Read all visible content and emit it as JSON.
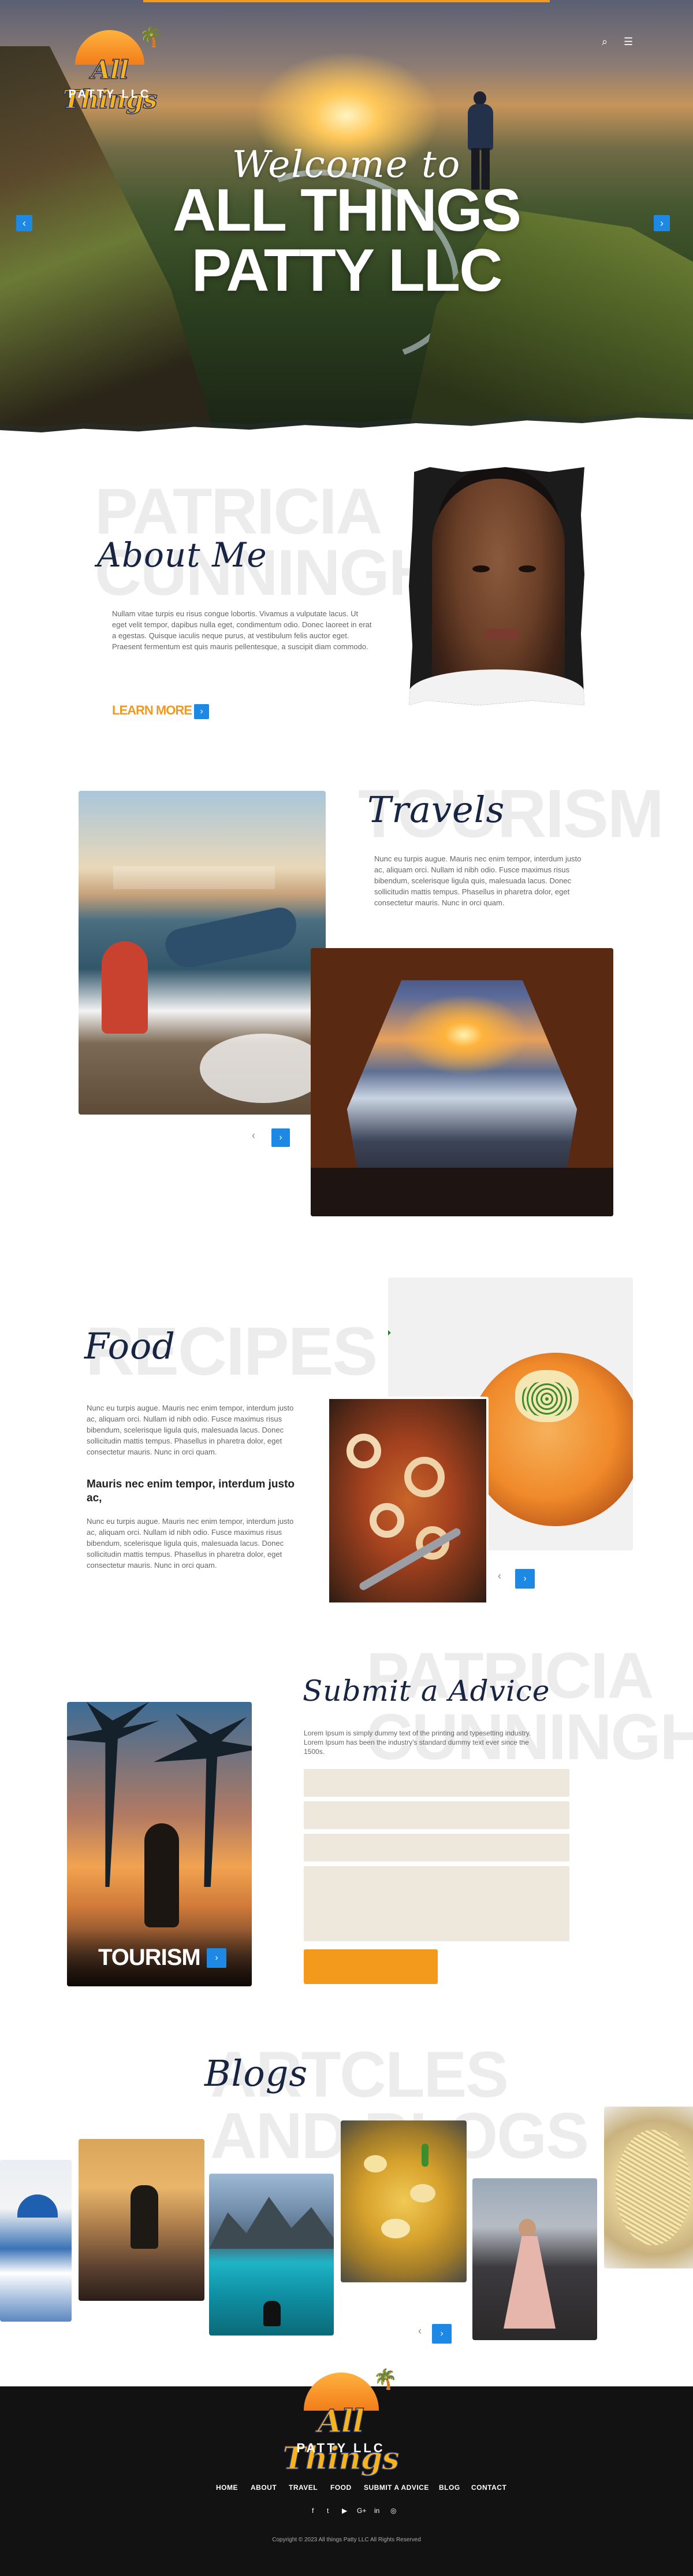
{
  "hero": {
    "welcome": "Welcome to",
    "title_line1": "ALL THINGS",
    "title_line2": "PATTY LLC",
    "prev": "‹",
    "next": "›",
    "search_icon": "⌕",
    "menu_icon": "☰"
  },
  "logo": {
    "line1": "All Things",
    "line2": "PATTY LLC"
  },
  "about": {
    "ghost_line1": "PATRICIA",
    "ghost_line2": "CUNNINGHAM",
    "heading": "About Me",
    "text": "Nullam vitae turpis eu risus congue lobortis. Vivamus a vulputate lacus. Ut eget velit tempor, dapibus nulla eget, condimentum odio. Donec laoreet in erat a egestas. Quisque iaculis neque purus, at vestibulum felis auctor eget. Praesent fermentum est quis mauris pellentesque, a suscipit diam commodo.",
    "cta": "LEARN MORE",
    "cta_icon": "›"
  },
  "travels": {
    "ghost": "TOURISM",
    "heading": "Travels",
    "text": "Nunc eu turpis augue. Mauris nec enim tempor, interdum justo ac, aliquam orci. Nullam id nibh odio. Fusce maximus risus bibendum, scelerisque ligula quis, malesuada lacus. Donec sollicitudin mattis tempus. Phasellus in pharetra dolor, eget consectetur mauris. Nunc in orci quam.",
    "prev": "‹",
    "next": "›"
  },
  "food": {
    "ghost": "RECIPES",
    "heading": "Food",
    "text1": "Nunc eu turpis augue. Mauris nec enim tempor, interdum justo ac, aliquam orci. Nullam id nibh odio. Fusce maximus risus bibendum, scelerisque ligula quis, malesuada lacus. Donec sollicitudin mattis tempus. Phasellus in pharetra dolor, eget consectetur mauris. Nunc in orci quam.",
    "subheading": "Mauris nec enim tempor, interdum justo ac,",
    "text2": "Nunc eu turpis augue. Mauris nec enim tempor, interdum justo ac, aliquam orci. Nullam id nibh odio. Fusce maximus risus bibendum, scelerisque ligula quis, malesuada lacus. Donec sollicitudin mattis tempus. Phasellus in pharetra dolor, eget consectetur mauris. Nunc in orci quam.",
    "prev": "‹",
    "next": "›"
  },
  "advice": {
    "ghost_line1": "PATRICIA",
    "ghost_line2": "CUNNINGHAM",
    "heading": "Submit a Advice",
    "text": "Lorem Ipsum is simply dummy text of the printing and typesetting industry. Lorem Ipsum has been the industry's standard dummy text ever since the 1500s.",
    "tourism_label": "TOURISM",
    "tourism_icon": "›"
  },
  "blogs": {
    "ghost_line1": "ARTCLES",
    "ghost_line2": "AND BLOGS",
    "heading": "Blogs",
    "prev": "‹",
    "next": "›"
  },
  "footer": {
    "logo_line1": "All Things",
    "logo_line2": "PATTY LLC",
    "nav": [
      "HOME",
      "ABOUT",
      "TRAVEL",
      "FOOD",
      "SUBMIT A ADVICE",
      "BLOG",
      "CONTACT"
    ],
    "social": [
      "f",
      "t",
      "▶",
      "G+",
      "in",
      "◎"
    ],
    "copyright": "Copyright © 2023 All things Patty LLC All Rights Reserved"
  },
  "colors": {
    "accent_orange": "#f39a1c",
    "accent_blue": "#1e88e5",
    "navy": "#182542",
    "form_field": "#ede8db"
  }
}
